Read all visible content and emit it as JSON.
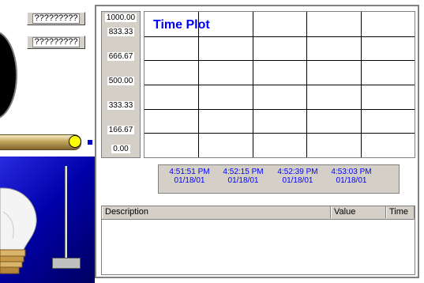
{
  "tags": [
    "?????????",
    "?????????"
  ],
  "trend": {
    "title": "Time Plot",
    "y_ticks": [
      "1000.00",
      "833.33",
      "666.67",
      "500.00",
      "333.33",
      "166.67",
      "0.00"
    ],
    "time_labels": [
      {
        "time": "4:51:51 PM",
        "date": "01/18/01"
      },
      {
        "time": "4:52:15 PM",
        "date": "01/18/01"
      },
      {
        "time": "4:52:39 PM",
        "date": "01/18/01"
      },
      {
        "time": "4:53:03 PM",
        "date": "01/18/01"
      }
    ]
  },
  "events_table": {
    "columns": [
      "Description",
      "Value",
      "Time"
    ]
  },
  "colors": {
    "title": "#0000ff",
    "time_labels": "#0000ff",
    "panel_bg": "#d4d0c8",
    "valve": "#ffff00",
    "bulb_bg": "#0000aa"
  },
  "icons": [
    "gauge-icon",
    "valve-icon",
    "light-bulb-icon"
  ],
  "chart_data": {
    "type": "line",
    "title": "Time Plot",
    "series": [],
    "ylim": [
      0,
      1000
    ],
    "yticks": [
      1000.0,
      833.33,
      666.67,
      500.0,
      333.33,
      166.67,
      0.0
    ],
    "xticks": [
      "4:51:51 PM 01/18/01",
      "4:52:15 PM 01/18/01",
      "4:52:39 PM 01/18/01",
      "4:53:03 PM 01/18/01"
    ],
    "grid": true
  }
}
